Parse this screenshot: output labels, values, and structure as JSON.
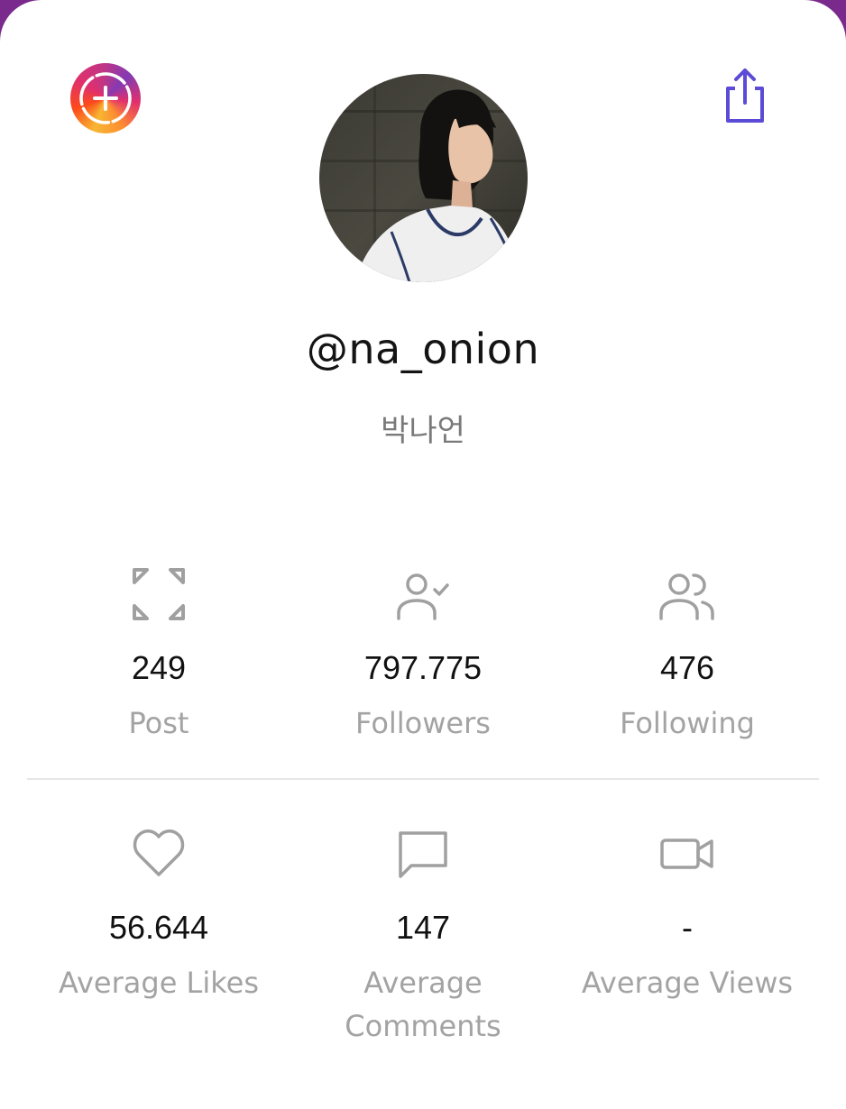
{
  "profile": {
    "username": "@na_onion",
    "display_name": "박나언"
  },
  "colors": {
    "accent": "#5b4bd6",
    "icon_gray": "#a0a0a0",
    "label_gray": "#a3a3a3",
    "frame_purple": "#7a2a8c"
  },
  "icons": {
    "story_add": "add-story-icon",
    "share": "share-icon",
    "post": "expand-icon",
    "followers": "user-check-icon",
    "following": "users-icon",
    "likes": "heart-icon",
    "comments": "comment-icon",
    "views": "video-icon"
  },
  "stats_top": [
    {
      "value": "249",
      "label": "Post"
    },
    {
      "value": "797.775",
      "label": "Followers"
    },
    {
      "value": "476",
      "label": "Following"
    }
  ],
  "stats_bottom": [
    {
      "value": "56.644",
      "label": "Average Likes"
    },
    {
      "value": "147",
      "label": "Average",
      "label2": "Comments"
    },
    {
      "value": "-",
      "label": "Average Views"
    }
  ]
}
